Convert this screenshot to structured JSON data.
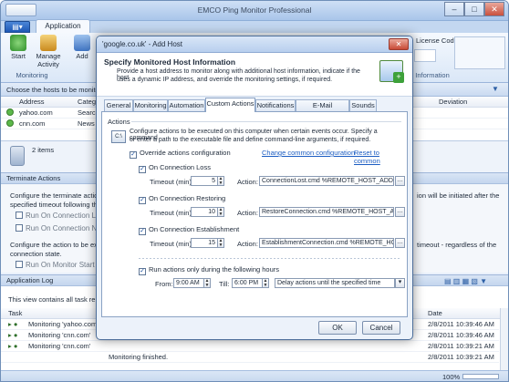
{
  "app": {
    "title": "EMCO Ping Monitor Professional",
    "menu_label": "",
    "tab_application": "Application"
  },
  "ribbon": {
    "start": "Start",
    "manage": "Manage",
    "activity": "Activity",
    "add": "Add",
    "group_monitoring": "Monitoring",
    "license_code": "License Code",
    "group_information": "Information"
  },
  "hostbar": {
    "label": "Choose the hosts to be monito"
  },
  "grid": {
    "columns": [
      "Address",
      "Categ",
      "Deviation"
    ],
    "rows": [
      {
        "address": "yahoo.com",
        "category": "Searc"
      },
      {
        "address": "cnn.com",
        "category": "News"
      }
    ]
  },
  "items_count": "2 items",
  "terminate": {
    "header": "Terminate Actions",
    "desc1": "Configure the terminate actio",
    "desc1b": "specified timeout following the",
    "desc1_right": "ion will be initiated after the",
    "run_loss": "Run On Connection Loss",
    "run_not_est": "Run On Connection Not Establ",
    "desc2": "Configure the action to be exe",
    "desc2b": "connection state.",
    "desc2_right": "timeout - regardless of the",
    "run_start": "Run On Monitor Start"
  },
  "applog": {
    "header": "Application Log",
    "desc": "This view contains all task re",
    "col_task": "Task",
    "col_date": "Date",
    "rows": [
      {
        "task": "Monitoring 'yahoo.com'",
        "date": "2/8/2011 10:39:46 AM"
      },
      {
        "task": "Monitoring 'cnn.com'",
        "date": "2/8/2011 10:39:46 AM"
      },
      {
        "task": "Monitoring 'cnn.com'",
        "date": "2/8/2011 10:39:21 AM"
      },
      {
        "task": "",
        "date": "2/8/2011 10:39:21 AM"
      }
    ],
    "overflow_text": "Monitoring finished."
  },
  "status": {
    "zoom": "100%"
  },
  "dialog": {
    "title": "'google.co.uk' - Add Host",
    "header_title": "Specify Monitored Host Information",
    "header_desc1": "Provide a host address to monitor along with additional host information, indicate if the host",
    "header_desc2": "uses a dynamic IP address, and override the monitoring settings, if required.",
    "tabs": [
      "General",
      "Monitoring",
      "Automation",
      "Custom Actions",
      "Notifications",
      "E-Mail Recipients",
      "Sounds"
    ],
    "actions_group": "Actions",
    "actions_desc1": "Configure actions to be executed on this computer when certain events occur. Specify a command",
    "actions_desc2": "or enter a path to the executable file and define command-line arguments, if required.",
    "override": "Override actions configuration",
    "change_common": "Change common configuration",
    "reset_common": "Reset to common",
    "timeout_label": "Timeout (min):",
    "action_label": "Action:",
    "loss_label": "On Connection Loss",
    "loss_timeout": "5",
    "loss_action": "ConnectionLost.cmd %REMOTE_HOST_ADDR",
    "restoring_label": "On Connection Restoring",
    "restoring_timeout": "10",
    "restoring_action": "RestoreConnection.cmd %REMOTE_HOST_AD",
    "establish_label": "On Connection Establishment",
    "establish_timeout": "15",
    "establish_action": "EstablishmentConnection.cmd %REMOTE_HO",
    "hours_label": "Run actions only during the following hours",
    "from_label": "From:",
    "from_value": "9:00 AM",
    "till_label": "Till:",
    "till_value": "6:00 PM",
    "delay_option": "Delay actions until the specified time",
    "ok": "OK",
    "cancel": "Cancel"
  }
}
